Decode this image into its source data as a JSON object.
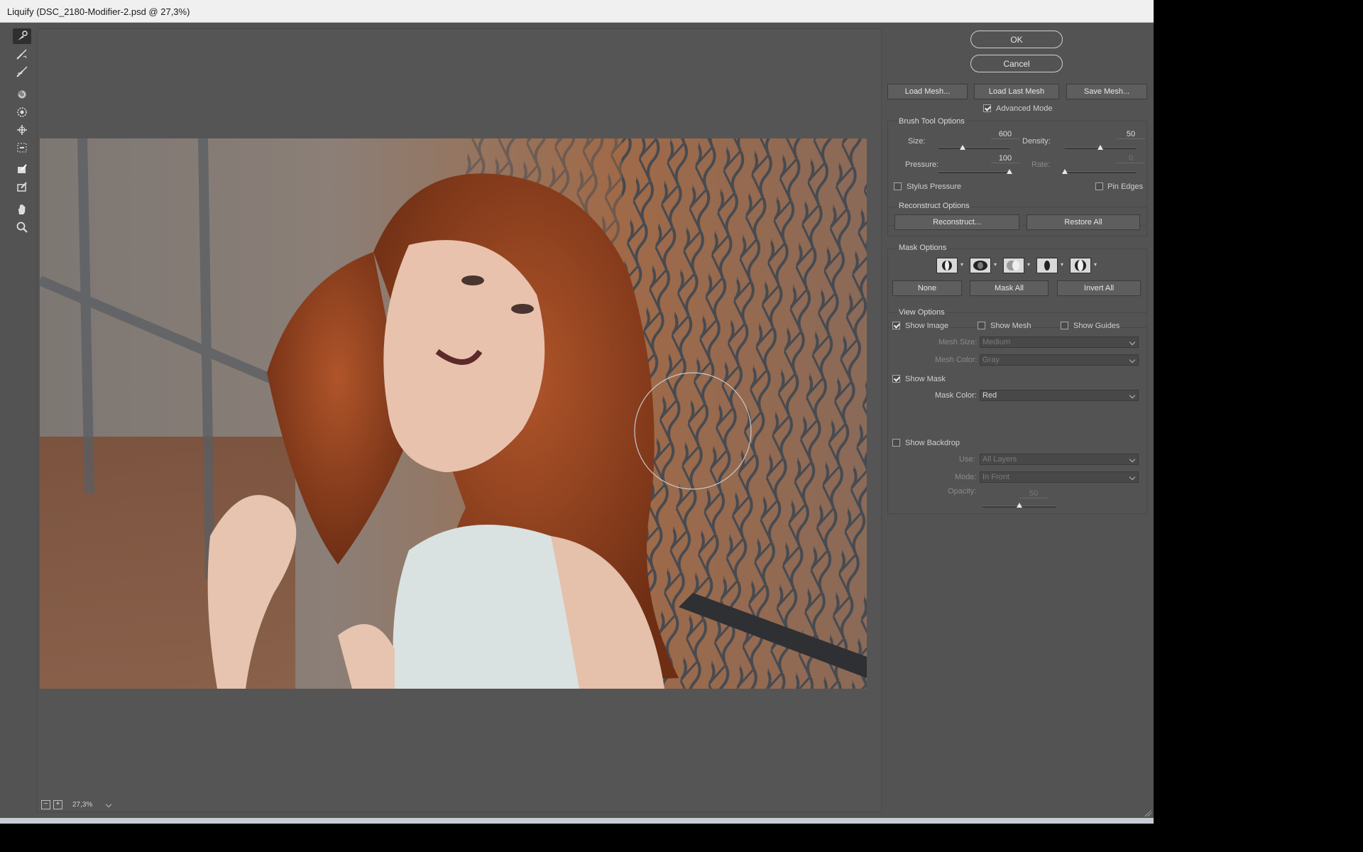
{
  "window": {
    "title": "Liquify (DSC_2180-Modifier-2.psd @ 27,3%)"
  },
  "tools": [
    "forward-warp-tool-icon",
    "reconstruct-tool-icon",
    "smooth-tool-icon",
    "twirl-clockwise-tool-icon",
    "pucker-tool-icon",
    "bloat-tool-icon",
    "push-left-tool-icon",
    "freeze-mask-tool-icon",
    "thaw-mask-tool-icon",
    "hand-tool-icon",
    "zoom-tool-icon"
  ],
  "zoom": {
    "value": "27,3%"
  },
  "buttons": {
    "ok": "OK",
    "cancel": "Cancel",
    "load_mesh": "Load Mesh...",
    "load_last_mesh": "Load Last Mesh",
    "save_mesh": "Save Mesh..."
  },
  "advanced_mode": {
    "label": "Advanced Mode",
    "checked": true
  },
  "brush": {
    "title": "Brush Tool Options",
    "size_label": "Size:",
    "size": "600",
    "size_level": 0.34,
    "density_label": "Density:",
    "density": "50",
    "density_level": 0.5,
    "pressure_label": "Pressure:",
    "pressure": "100",
    "pressure_level": 1.0,
    "rate_label": "Rate:",
    "rate": "0",
    "rate_level": 0.0,
    "stylus_label": "Stylus Pressure",
    "pin_edges_label": "Pin Edges"
  },
  "reconstruct": {
    "title": "Reconstruct Options",
    "reconstruct_btn": "Reconstruct...",
    "restore_all_btn": "Restore All"
  },
  "mask": {
    "title": "Mask Options",
    "none_btn": "None",
    "mask_all_btn": "Mask All",
    "invert_all_btn": "Invert All"
  },
  "view": {
    "title": "View Options",
    "show_image": "Show Image",
    "show_mesh": "Show Mesh",
    "show_guides": "Show Guides",
    "mesh_size_label": "Mesh Size:",
    "mesh_size": "Medium",
    "mesh_color_label": "Mesh Color:",
    "mesh_color": "Gray",
    "show_mask": "Show Mask",
    "mask_color_label": "Mask Color:",
    "mask_color": "Red",
    "show_backdrop": "Show Backdrop",
    "use_label": "Use:",
    "use": "All Layers",
    "mode_label": "Mode:",
    "mode": "In Front",
    "opacity_label": "Opacity:",
    "opacity": "50",
    "opacity_level": 0.5
  }
}
